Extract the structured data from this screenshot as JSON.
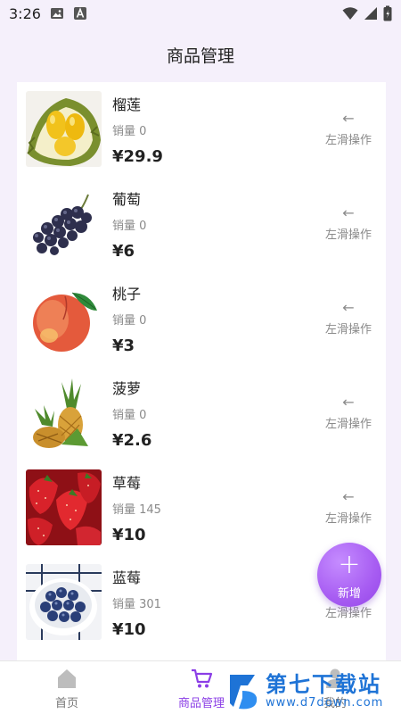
{
  "status_bar": {
    "time": "3:26"
  },
  "header": {
    "title": "商品管理"
  },
  "products": [
    {
      "name": "榴莲",
      "sales": "销量 0",
      "price": "¥29.9",
      "image": "durian"
    },
    {
      "name": "葡萄",
      "sales": "销量 0",
      "price": "¥6",
      "image": "grapes"
    },
    {
      "name": "桃子",
      "sales": "销量 0",
      "price": "¥3",
      "image": "peach"
    },
    {
      "name": "菠萝",
      "sales": "销量 0",
      "price": "¥2.6",
      "image": "pineapple"
    },
    {
      "name": "草莓",
      "sales": "销量 145",
      "price": "¥10",
      "image": "strawberry"
    },
    {
      "name": "蓝莓",
      "sales": "销量 301",
      "price": "¥10",
      "image": "blueberry"
    }
  ],
  "swipe_hint": {
    "arrow": "←",
    "label": "左滑操作"
  },
  "fab": {
    "icon": "+",
    "label": "新增"
  },
  "tabbar": {
    "tabs": [
      {
        "label": "首页",
        "icon": "home-icon",
        "active": false
      },
      {
        "label": "商品管理",
        "icon": "cart-icon",
        "active": true
      },
      {
        "label": "我的",
        "icon": "person-icon",
        "active": false
      }
    ]
  },
  "watermark": {
    "title": "第七下载站",
    "url": "www.d7down.com"
  },
  "colors": {
    "accent": "#8b3ee6",
    "background": "#f5f0fb",
    "watermark": "#1e73d6"
  }
}
